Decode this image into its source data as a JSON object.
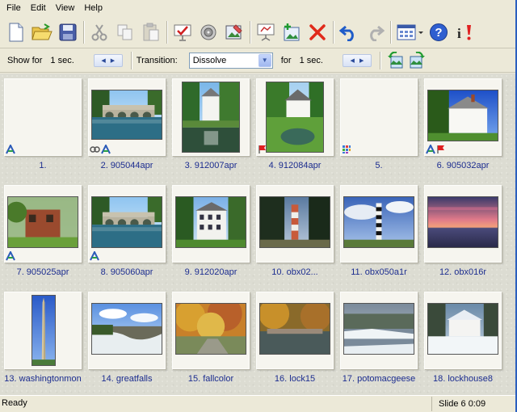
{
  "menu": [
    "File",
    "Edit",
    "View",
    "Help"
  ],
  "toolbar": {
    "icons": [
      "new-document-icon",
      "open-folder-icon",
      "save-disk-icon",
      "cut-scissors-icon",
      "copy-icon",
      "paste-icon",
      "slide-properties-icon",
      "sound-icon",
      "edit-image-icon",
      "presentation-icon",
      "add-image-icon",
      "delete-x-icon",
      "undo-icon",
      "redo-icon",
      "view-mode-icon",
      "help-icon",
      "info-icon"
    ]
  },
  "options": {
    "show_for_label": "Show for",
    "show_for_value": "1 sec.",
    "transition_label": "Transition:",
    "transition_value": "Dissolve",
    "for_label": "for",
    "for_value": "1 sec."
  },
  "slides": [
    {
      "caption": "1.",
      "photo": "blank",
      "marks": [
        "a"
      ]
    },
    {
      "caption": "2. 905044apr",
      "photo": "bridge",
      "marks": [
        "link",
        "a"
      ]
    },
    {
      "caption": "3. 912007apr",
      "photo": "house-pond",
      "marks": []
    },
    {
      "caption": "4. 912084apr",
      "photo": "house-lawn",
      "marks": [
        "flag"
      ]
    },
    {
      "caption": "5.",
      "photo": "blank",
      "marks": [
        "grid"
      ]
    },
    {
      "caption": "6. 905032apr",
      "photo": "white-house",
      "marks": [
        "a",
        "flag"
      ]
    },
    {
      "caption": "7. 905025apr",
      "photo": "ruin",
      "marks": [
        "a"
      ]
    },
    {
      "caption": "8. 905060apr",
      "photo": "bridge",
      "marks": [
        "a"
      ]
    },
    {
      "caption": "9. 912020apr",
      "photo": "white-house2",
      "marks": []
    },
    {
      "caption": "10. obx02...",
      "photo": "lighthouse-dark",
      "marks": []
    },
    {
      "caption": "11. obx050a1r",
      "photo": "lighthouse",
      "marks": []
    },
    {
      "caption": "12. obx016r",
      "photo": "sunset",
      "marks": []
    },
    {
      "caption": "13. washingtonmon",
      "photo": "monument",
      "marks": []
    },
    {
      "caption": "14. greatfalls",
      "photo": "falls",
      "marks": []
    },
    {
      "caption": "15. fallcolor",
      "photo": "fallcolor",
      "marks": []
    },
    {
      "caption": "16. lock15",
      "photo": "lock",
      "marks": []
    },
    {
      "caption": "17. potomacgeese",
      "photo": "snow-river",
      "marks": []
    },
    {
      "caption": "18. lockhouse8",
      "photo": "snow-house",
      "marks": []
    }
  ],
  "status": {
    "left": "Ready",
    "right": "Slide 6  0:09"
  }
}
